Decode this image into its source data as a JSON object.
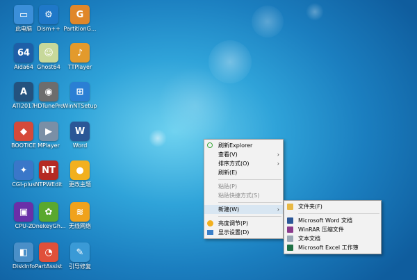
{
  "desktop": {
    "icons": [
      {
        "label": "此电脑",
        "icon": "computer-icon",
        "glyph": "▭",
        "color": "#3b8fd9"
      },
      {
        "label": "Dism++",
        "icon": "gear-icon",
        "glyph": "⚙",
        "color": "#1f78c8"
      },
      {
        "label": "PartitionG...",
        "icon": "partition-guru-icon",
        "glyph": "G",
        "color": "#e0872a"
      },
      {
        "label": "Aida64",
        "icon": "aida64-icon",
        "glyph": "64",
        "color": "#1e5fa8"
      },
      {
        "label": "Ghost64",
        "icon": "ghost-icon",
        "glyph": "☺",
        "color": "#c7d89a"
      },
      {
        "label": "TTPlayer",
        "icon": "ttplayer-icon",
        "glyph": "♪",
        "color": "#e39a2c"
      },
      {
        "label": "ATI2017",
        "icon": "ati-icon",
        "glyph": "A",
        "color": "#24527e"
      },
      {
        "label": "HDTunePro",
        "icon": "harddisk-icon",
        "glyph": "◉",
        "color": "#6d6d6d"
      },
      {
        "label": "WinNTSetup",
        "icon": "windows-icon",
        "glyph": "⊞",
        "color": "#2a7fd4"
      },
      {
        "label": "BOOTICE",
        "icon": "bootice-icon",
        "glyph": "◆",
        "color": "#d64a3a"
      },
      {
        "label": "MPlayer",
        "icon": "mplayer-icon",
        "glyph": "▶",
        "color": "#7a8fa6"
      },
      {
        "label": "Word",
        "icon": "word-icon",
        "glyph": "W",
        "color": "#2b5797"
      },
      {
        "label": "CGI-plus",
        "icon": "cgi-icon",
        "glyph": "✦",
        "color": "#3a77c9"
      },
      {
        "label": "NTPWEdit",
        "icon": "ntpwedit-icon",
        "glyph": "NT",
        "color": "#b52a24"
      },
      {
        "label": "更改主题",
        "icon": "pacman-icon",
        "glyph": "●",
        "color": "#f2b01e"
      },
      {
        "label": "CPU-Z",
        "icon": "cpu-icon",
        "glyph": "▣",
        "color": "#6a2fa8"
      },
      {
        "label": "OnekeyGh...",
        "icon": "onekeyghost-icon",
        "glyph": "✿",
        "color": "#5aa82e"
      },
      {
        "label": "无线网络",
        "icon": "wifi-icon",
        "glyph": "≋",
        "color": "#f0a21c"
      },
      {
        "label": "DiskInfo",
        "icon": "diskinfo-icon",
        "glyph": "◧",
        "color": "#4a8fc8"
      },
      {
        "label": "PartAssist",
        "icon": "partassist-icon",
        "glyph": "◔",
        "color": "#e0503a"
      },
      {
        "label": "引导修复",
        "icon": "wrench-icon",
        "glyph": "✎",
        "color": "#3a9ad6"
      }
    ]
  },
  "context_menu": {
    "items": [
      {
        "label": "刷新Explorer",
        "icon": "refresh-icon",
        "type": "item"
      },
      {
        "label": "查看(V)",
        "type": "item",
        "submenu": true
      },
      {
        "label": "排序方式(O)",
        "type": "item",
        "submenu": true
      },
      {
        "label": "刷新(E)",
        "type": "item"
      },
      {
        "label": "粘贴(P)",
        "type": "item",
        "disabled": true
      },
      {
        "label": "粘贴快捷方式(S)",
        "type": "item",
        "disabled": true
      },
      {
        "label": "新建(W)",
        "type": "item",
        "submenu": true,
        "hover": true
      },
      {
        "label": "亮度调节(P)",
        "icon": "brightness-icon",
        "type": "item"
      },
      {
        "label": "显示设置(D)",
        "icon": "display-icon",
        "type": "item"
      }
    ]
  },
  "submenu_new": {
    "items": [
      {
        "label": "文件夹(F)",
        "icon": "folder-icon",
        "color": "#e8b844"
      },
      {
        "label": "Microsoft Word 文档",
        "icon": "word-doc-icon",
        "color": "#2b5797"
      },
      {
        "label": "WinRAR 压缩文件",
        "icon": "winrar-icon",
        "color": "#8a3a8c"
      },
      {
        "label": "文本文档",
        "icon": "text-doc-icon",
        "color": "#9aa7b5"
      },
      {
        "label": "Microsoft Excel 工作簿",
        "icon": "excel-doc-icon",
        "color": "#1e7145"
      }
    ]
  }
}
